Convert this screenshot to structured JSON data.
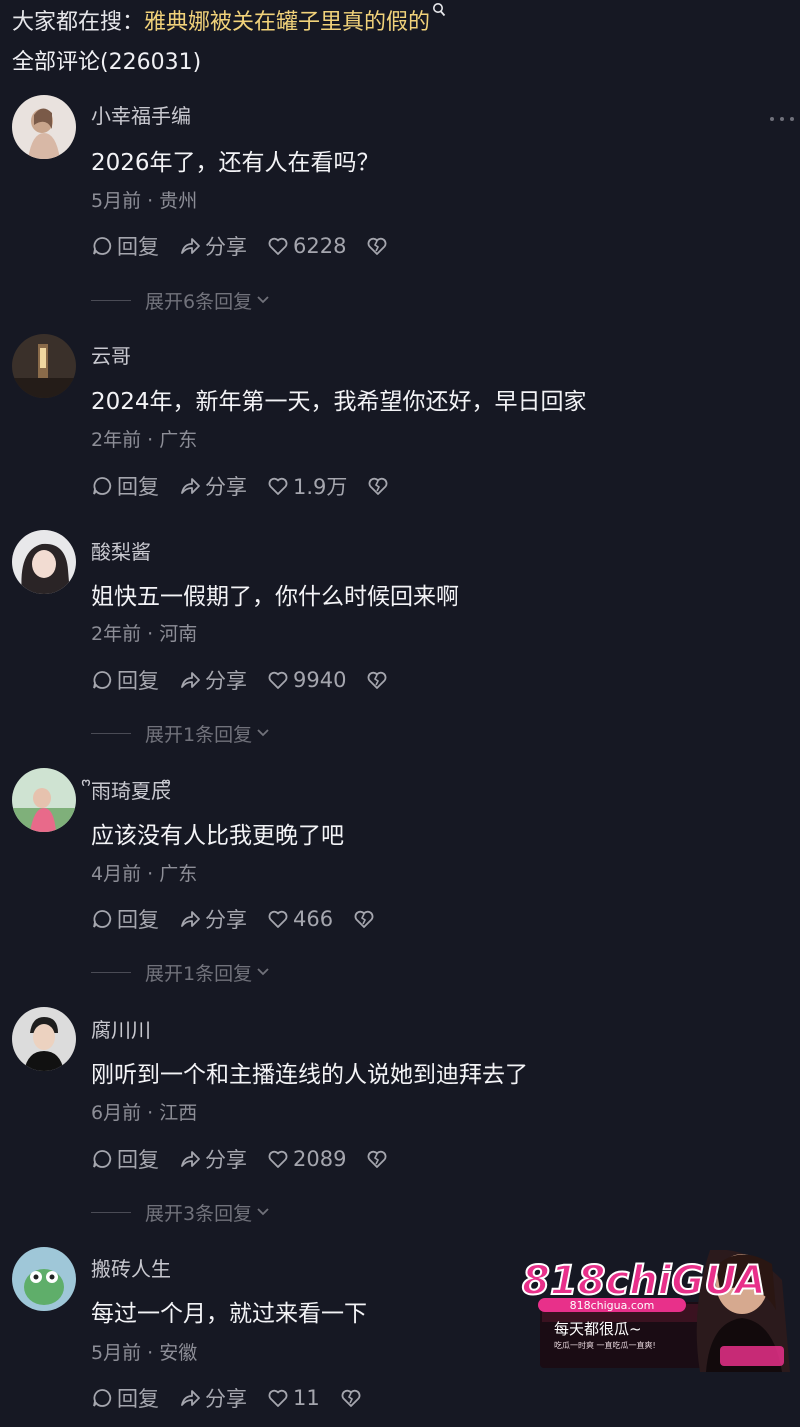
{
  "search": {
    "prefix": "大家都在搜：",
    "term": "雅典娜被关在罐子里真的假的"
  },
  "comments_count": "全部评论(226031)",
  "labels": {
    "reply": "回复",
    "share": "分享"
  },
  "comments": [
    {
      "user": "小幸福手编",
      "text": "2026年了，还有人在看吗？",
      "meta": "5月前 · 贵州",
      "likes": "6228",
      "expand": "展开6条回复"
    },
    {
      "user": "云哥",
      "text": "2024年，新年第一天，我希望你还好，早日回家",
      "meta": "2年前 · 广东",
      "likes": "1.9万",
      "expand": ""
    },
    {
      "user": "酸梨酱",
      "text": "姐快五一假期了，你什么时候回来啊",
      "meta": "2年前 · 河南",
      "likes": "9940",
      "expand": "展开1条回复"
    },
    {
      "user": "ᩚ雨琦夏辰ᩚ",
      "text": "应该没有人比我更晚了吧",
      "meta": "4月前 · 广东",
      "likes": "466",
      "expand": "展开1条回复"
    },
    {
      "user": "腐川川",
      "text": "刚听到一个和主播连线的人说她到迪拜去了",
      "meta": "6月前 · 江西",
      "likes": "2089",
      "expand": "展开3条回复"
    },
    {
      "user": "搬砖人生",
      "text": "每过一个月，就过来看一下",
      "meta": "5月前 · 安徽",
      "likes": "11",
      "expand": ""
    }
  ],
  "ad": {
    "brand": "818chiGUA",
    "url": "818chigua.com",
    "slogan": "每天都很瓜~",
    "sub": "吃瓜一时爽 一直吃瓜一直爽!",
    "colors": {
      "pink": "#e8308a",
      "dark": "#1a0c14"
    }
  },
  "colors": {
    "background": "#161823",
    "search_term": "#f1d27a",
    "muted": "#8d8e97"
  }
}
